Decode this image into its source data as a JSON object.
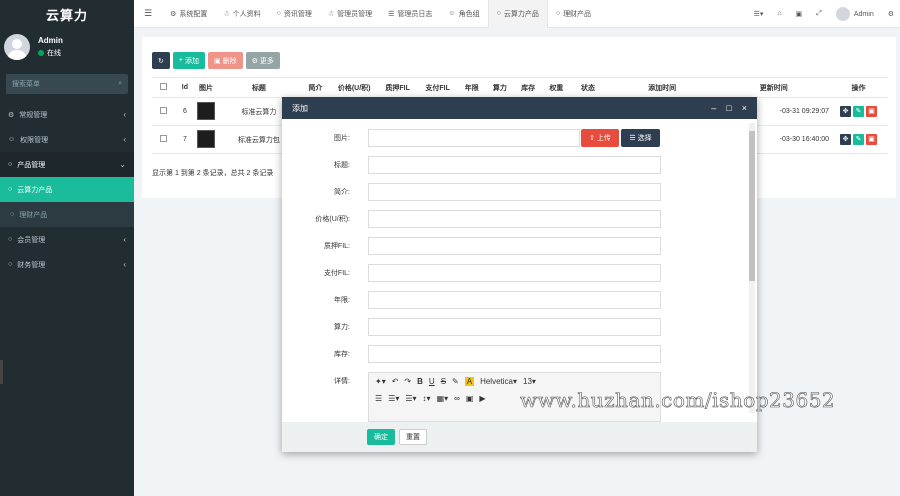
{
  "app": {
    "title": "云算力"
  },
  "user": {
    "name": "Admin",
    "status": "在线"
  },
  "sidebar": {
    "search_placeholder": "搜索菜单",
    "items": [
      {
        "label": "常规管理",
        "icon": "gear-icon",
        "state": "normal"
      },
      {
        "label": "权限管理",
        "icon": "group-icon",
        "state": "normal"
      },
      {
        "label": "产品管理",
        "icon": "circle-icon",
        "state": "open"
      },
      {
        "label": "云算力产品",
        "icon": "circle-icon",
        "state": "active"
      },
      {
        "label": "理财产品",
        "icon": "circle-icon",
        "state": "sub"
      },
      {
        "label": "会员管理",
        "icon": "circle-icon",
        "state": "normal"
      },
      {
        "label": "财务管理",
        "icon": "circle-icon",
        "state": "normal"
      }
    ]
  },
  "topnav": {
    "tabs": [
      {
        "label": "系统配置",
        "icon": "gear-icon"
      },
      {
        "label": "个人资料",
        "icon": "user-icon"
      },
      {
        "label": "资讯管理",
        "icon": "circle-icon"
      },
      {
        "label": "管理员管理",
        "icon": "user-icon"
      },
      {
        "label": "管理员日志",
        "icon": "list-icon"
      },
      {
        "label": "角色组",
        "icon": "group-icon"
      },
      {
        "label": "云算力产品",
        "icon": "circle-icon",
        "active": true
      },
      {
        "label": "理财产品",
        "icon": "circle-icon"
      }
    ],
    "user_label": "Admin"
  },
  "toolbar": {
    "add": "添加",
    "delete": "删除",
    "more": "更多"
  },
  "table": {
    "headers": [
      "Id",
      "图片",
      "标题",
      "简介",
      "价格(U/积)",
      "质押FIL",
      "支付FIL",
      "年限",
      "算力",
      "库存",
      "权重",
      "状态",
      "添加时间",
      "更新时间",
      "操作"
    ],
    "rows": [
      {
        "id": "6",
        "title": "标准云算力",
        "updated": "-03-31 09:29:07"
      },
      {
        "id": "7",
        "title": "标准云算力包",
        "updated": "-03-30 16:40:00"
      }
    ],
    "footer": "显示第 1 到第 2 条记录，总共 2 条记录"
  },
  "modal": {
    "title": "添加",
    "fields": [
      "图片:",
      "标题:",
      "简介:",
      "价格(U/积):",
      "质押FIL:",
      "支付FIL:",
      "年限:",
      "算力:",
      "库存:",
      "详情:"
    ],
    "upload": "上传",
    "choose": "选择",
    "editor": {
      "font": "Helvetica",
      "size": "13"
    },
    "ok": "确定",
    "reset": "重置"
  },
  "watermark": "www.huzhan.com/ishop23652",
  "colors": {
    "sidebar": "#222d32",
    "accent": "#1abc9c",
    "header_dark": "#2c3e50",
    "danger": "#e74c3c"
  }
}
